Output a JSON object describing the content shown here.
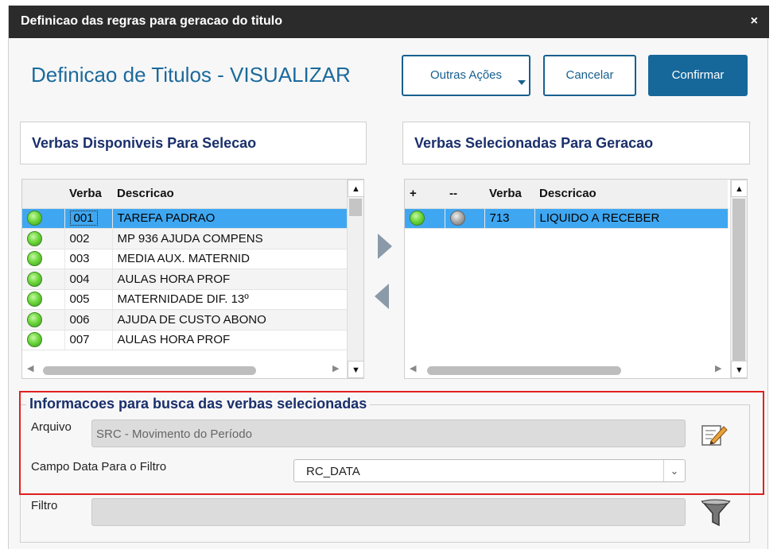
{
  "window": {
    "title": "Definicao das regras para geracao do titulo",
    "close_glyph": "×"
  },
  "header": {
    "page_title": "Definicao de Titulos - VISUALIZAR"
  },
  "actions": {
    "outras": "Outras Ações",
    "cancelar": "Cancelar",
    "confirmar": "Confirmar"
  },
  "left_panel": {
    "title": "Verbas Disponiveis Para Selecao",
    "columns": [
      "",
      "Verba",
      "Descricao"
    ],
    "rows": [
      {
        "code": "001",
        "desc": "TAREFA PADRAO",
        "selected": true
      },
      {
        "code": "002",
        "desc": "MP 936 AJUDA COMPENS"
      },
      {
        "code": "003",
        "desc": "MEDIA AUX. MATERNID"
      },
      {
        "code": "004",
        "desc": "AULAS HORA PROF"
      },
      {
        "code": "005",
        "desc": "MATERNIDADE DIF. 13º"
      },
      {
        "code": "006",
        "desc": "AJUDA DE CUSTO ABONO"
      },
      {
        "code": "007",
        "desc": "AULAS HORA PROF"
      }
    ]
  },
  "right_panel": {
    "title": "Verbas Selecionadas Para Geracao",
    "columns": [
      "+",
      "--",
      "Verba",
      "Descricao"
    ],
    "rows": [
      {
        "code": "713",
        "desc": "LIQUIDO A RECEBER",
        "selected": true
      }
    ]
  },
  "info": {
    "title": "Informacoes para busca das verbas selecionadas",
    "arquivo_label": "Arquivo",
    "arquivo_value": "SRC - Movimento do Período",
    "campo_label": "Campo Data Para o Filtro",
    "campo_value": "RC_DATA",
    "filtro_label": "Filtro",
    "filtro_value": ""
  },
  "icons": {
    "edit": "edit-icon",
    "filter": "filter-icon",
    "status_ok": "green-ball-icon",
    "status_off": "grey-ball-icon"
  },
  "colors": {
    "accent": "#16679a",
    "title_bar": "#2b2b2b",
    "selection": "#3fa7f1",
    "highlight_border": "#e02020"
  }
}
